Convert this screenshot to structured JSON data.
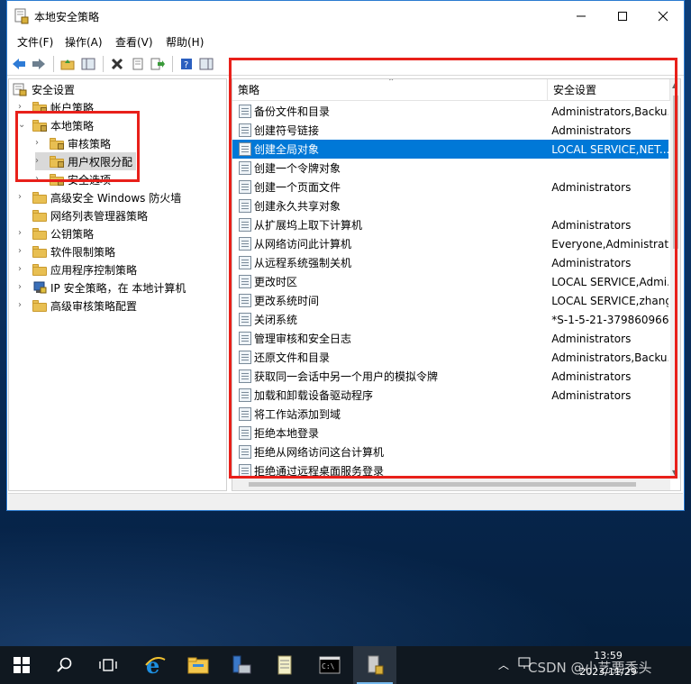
{
  "window": {
    "title": "本地安全策略"
  },
  "menu": [
    "文件(F)",
    "操作(A)",
    "查看(V)",
    "帮助(H)"
  ],
  "tree": {
    "root": "安全设置",
    "items": [
      {
        "label": "帐户策略",
        "level": 1
      },
      {
        "label": "本地策略",
        "level": 1,
        "expanded": true
      },
      {
        "label": "审核策略",
        "level": 2
      },
      {
        "label": "用户权限分配",
        "level": 2,
        "selected": true
      },
      {
        "label": "安全选项",
        "level": 2
      },
      {
        "label": "高级安全 Windows 防火墙",
        "level": 1
      },
      {
        "label": "网络列表管理器策略",
        "level": 1
      },
      {
        "label": "公钥策略",
        "level": 1
      },
      {
        "label": "软件限制策略",
        "level": 1
      },
      {
        "label": "应用程序控制策略",
        "level": 1
      },
      {
        "label": "IP 安全策略，在 本地计算机",
        "level": 1
      },
      {
        "label": "高级审核策略配置",
        "level": 1
      }
    ]
  },
  "list": {
    "col_policy": "策略",
    "col_setting": "安全设置",
    "rows": [
      {
        "name": "备份文件和目录",
        "setting": "Administrators,Backu..."
      },
      {
        "name": "创建符号链接",
        "setting": "Administrators"
      },
      {
        "name": "创建全局对象",
        "setting": "LOCAL SERVICE,NET...",
        "selected": true
      },
      {
        "name": "创建一个令牌对象",
        "setting": ""
      },
      {
        "name": "创建一个页面文件",
        "setting": "Administrators"
      },
      {
        "name": "创建永久共享对象",
        "setting": ""
      },
      {
        "name": "从扩展坞上取下计算机",
        "setting": "Administrators"
      },
      {
        "name": "从网络访问此计算机",
        "setting": "Everyone,Administrat..."
      },
      {
        "name": "从远程系统强制关机",
        "setting": "Administrators"
      },
      {
        "name": "更改时区",
        "setting": "LOCAL SERVICE,Admi..."
      },
      {
        "name": "更改系统时间",
        "setting": "LOCAL SERVICE,zhang"
      },
      {
        "name": "关闭系统",
        "setting": "*S-1-5-21-379860966..."
      },
      {
        "name": "管理审核和安全日志",
        "setting": "Administrators"
      },
      {
        "name": "还原文件和目录",
        "setting": "Administrators,Backu..."
      },
      {
        "name": "获取同一会话中另一个用户的模拟令牌",
        "setting": "Administrators"
      },
      {
        "name": "加载和卸载设备驱动程序",
        "setting": "Administrators"
      },
      {
        "name": "将工作站添加到域",
        "setting": ""
      },
      {
        "name": "拒绝本地登录",
        "setting": ""
      },
      {
        "name": "拒绝从网络访问这台计算机",
        "setting": ""
      },
      {
        "name": "拒绝通过远程桌面服务登录",
        "setting": ""
      }
    ]
  },
  "taskbar": {
    "time": "13:59",
    "date": "2023/11/29",
    "watermark": "CSDN @小艺要秃头"
  },
  "colors": {
    "selection": "#0078d7",
    "annotation": "#e8201a"
  }
}
